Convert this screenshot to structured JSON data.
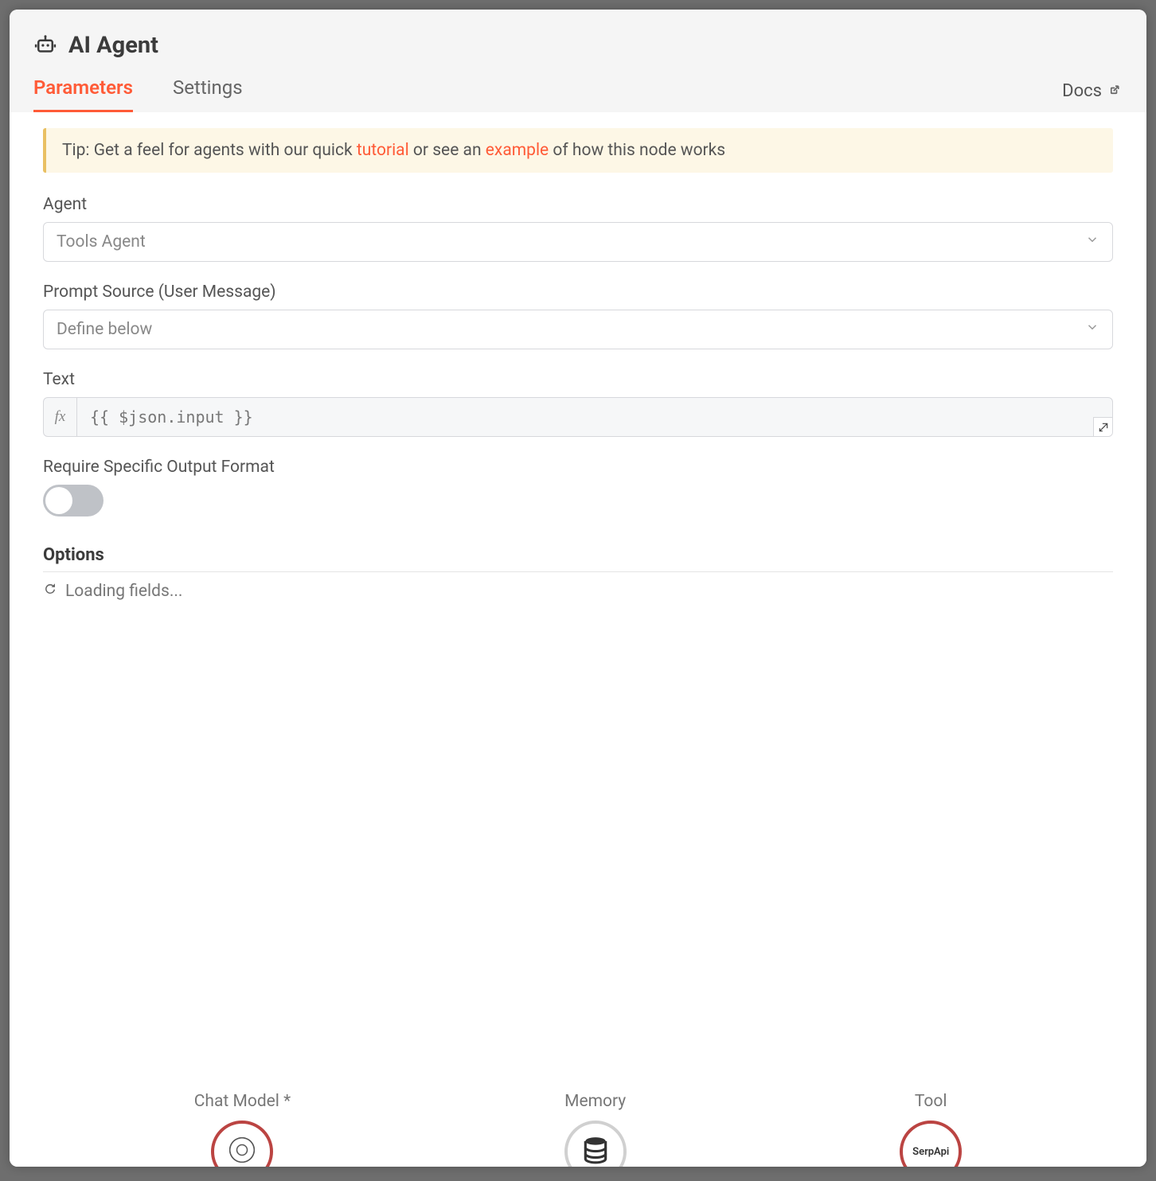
{
  "header": {
    "title": "AI Agent",
    "tabs": {
      "parameters": "Parameters",
      "settings": "Settings"
    },
    "docs": "Docs"
  },
  "tip": {
    "prefix": "Tip: Get a feel for agents with our quick ",
    "tutorial_link": "tutorial",
    "middle": " or see an ",
    "example_link": "example",
    "suffix": " of how this node works"
  },
  "fields": {
    "agent_label": "Agent",
    "agent_value": "Tools Agent",
    "prompt_source_label": "Prompt Source (User Message)",
    "prompt_source_value": "Define below",
    "text_label": "Text",
    "text_prefix": "fx",
    "text_value": "{{ $json.input }}",
    "require_format_label": "Require Specific Output Format",
    "options_heading": "Options",
    "loading_text": "Loading fields..."
  },
  "connectors": {
    "chat_model": "Chat Model *",
    "memory": "Memory",
    "tool": "Tool",
    "tool_node_text": "SerpApi"
  }
}
